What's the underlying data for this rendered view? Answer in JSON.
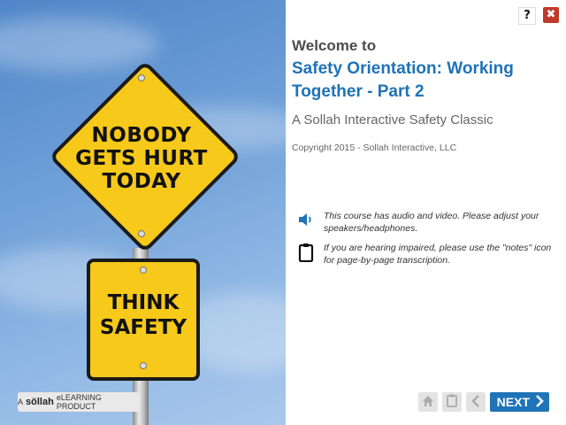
{
  "image": {
    "diamond_sign_text": [
      "NOBODY",
      "GETS HURT",
      "TODAY"
    ],
    "square_sign_text": [
      "THINK",
      "SAFETY"
    ],
    "sign_color": "#f6c91a"
  },
  "badge": {
    "prefix": "A",
    "brand": "söllah",
    "suffix": "eLEARNING PRODUCT"
  },
  "header": {
    "help_label": "?",
    "close_label": "✖"
  },
  "content": {
    "welcome": "Welcome to",
    "course_title": "Safety Orientation: Working Together - Part 2",
    "subtitle": "A Sollah Interactive Safety Classic",
    "copyright": "Copyright 2015 - Sollah Interactive, LLC"
  },
  "notes": [
    {
      "icon": "speaker-icon",
      "text": "This course has audio and video. Please adjust your speakers/headphones."
    },
    {
      "icon": "clipboard-icon",
      "text": "If you are hearing impaired, please use the \"notes\" icon for page-by-page transcription."
    }
  ],
  "nav": {
    "home_icon": "home-icon",
    "notes_icon": "clipboard-icon",
    "back_icon": "chevron-left-icon",
    "next_label": "NEXT"
  },
  "colors": {
    "accent": "#1f73b7",
    "close": "#c0392b",
    "nav_disabled": "#e3e3e3"
  }
}
